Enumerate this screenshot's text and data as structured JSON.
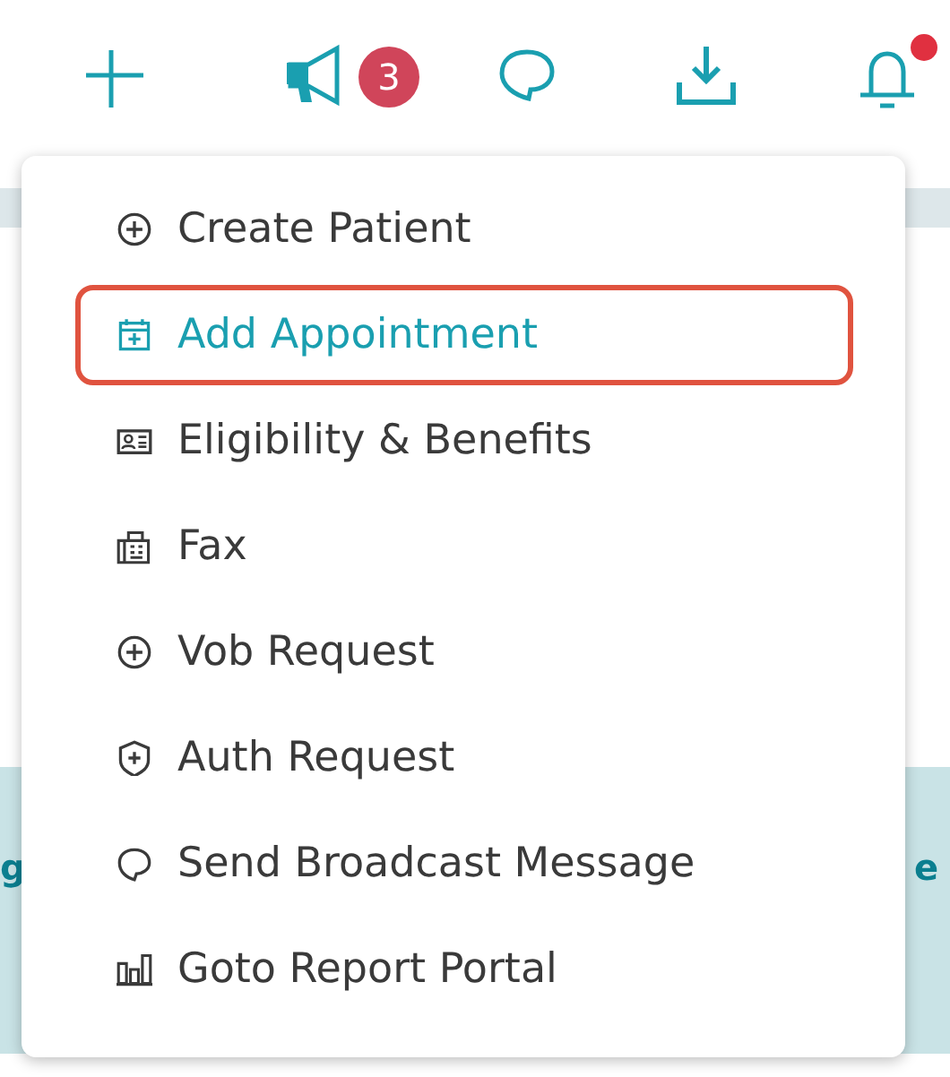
{
  "toolbar": {
    "buttons": [
      {
        "kind": "plus"
      },
      {
        "kind": "megaphone",
        "badge": "3"
      },
      {
        "kind": "chat"
      },
      {
        "kind": "download"
      },
      {
        "kind": "bell",
        "has_unread": true
      }
    ]
  },
  "background": {
    "left_fragment": "g",
    "right_fragment": "e"
  },
  "menu": {
    "items": [
      {
        "kind": "circle-plus",
        "label": "Create Patient",
        "selected": false
      },
      {
        "kind": "calendar-plus",
        "label": "Add Appointment",
        "selected": true
      },
      {
        "kind": "id-card",
        "label": "Eligibility & Benefits",
        "selected": false
      },
      {
        "kind": "fax",
        "label": "Fax",
        "selected": false
      },
      {
        "kind": "circle-plus",
        "label": "Vob Request",
        "selected": false
      },
      {
        "kind": "shield-plus",
        "label": "Auth Request",
        "selected": false
      },
      {
        "kind": "chat",
        "label": "Send Broadcast Message",
        "selected": false
      },
      {
        "kind": "chart",
        "label": "Goto Report Portal",
        "selected": false
      }
    ]
  }
}
